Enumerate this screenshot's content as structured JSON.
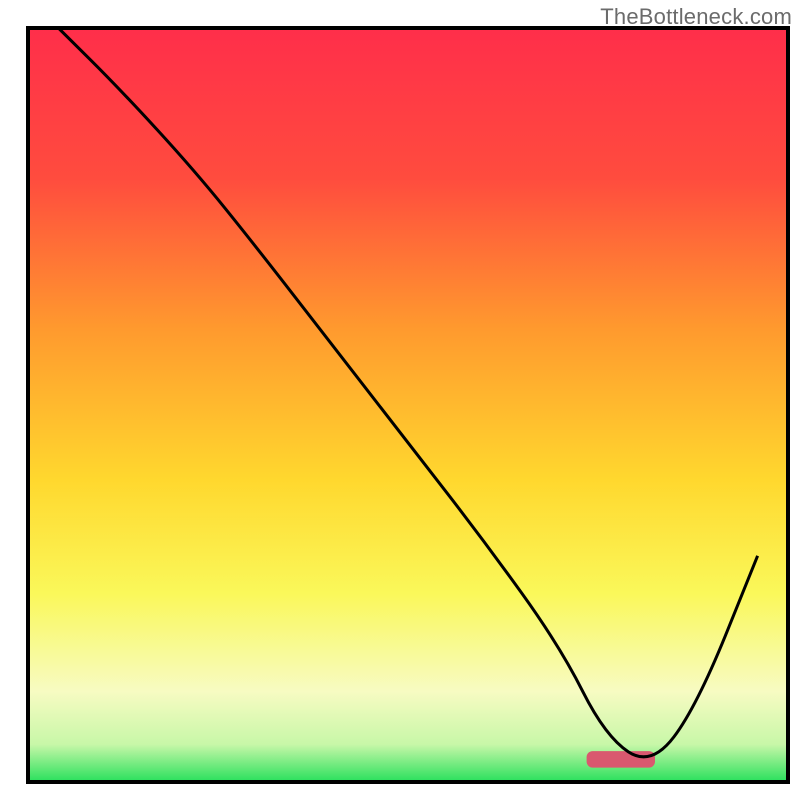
{
  "watermark": "TheBottleneck.com",
  "chart_data": {
    "type": "line",
    "title": "",
    "xlabel": "",
    "ylabel": "",
    "xlim": [
      0,
      100
    ],
    "ylim": [
      0,
      100
    ],
    "gradient_stops": [
      {
        "offset": 0.0,
        "color": "#ff2e4a"
      },
      {
        "offset": 0.2,
        "color": "#ff4c3e"
      },
      {
        "offset": 0.4,
        "color": "#ff9a2e"
      },
      {
        "offset": 0.6,
        "color": "#ffd82e"
      },
      {
        "offset": 0.75,
        "color": "#faf85a"
      },
      {
        "offset": 0.88,
        "color": "#f7fbc2"
      },
      {
        "offset": 0.95,
        "color": "#c8f7a8"
      },
      {
        "offset": 1.0,
        "color": "#28e05c"
      }
    ],
    "series": [
      {
        "name": "bottleneck-curve",
        "x": [
          4,
          12,
          22,
          30,
          40,
          50,
          60,
          70,
          76,
          82,
          88,
          96
        ],
        "values": [
          100,
          92,
          81,
          71,
          58,
          45,
          32,
          18,
          6,
          2,
          10,
          30
        ]
      }
    ],
    "marker": {
      "x": 78,
      "y": 3,
      "width": 9,
      "height": 2.2,
      "color": "#d9586f"
    },
    "frame": {
      "stroke": "#000000",
      "stroke_width": 4
    }
  }
}
